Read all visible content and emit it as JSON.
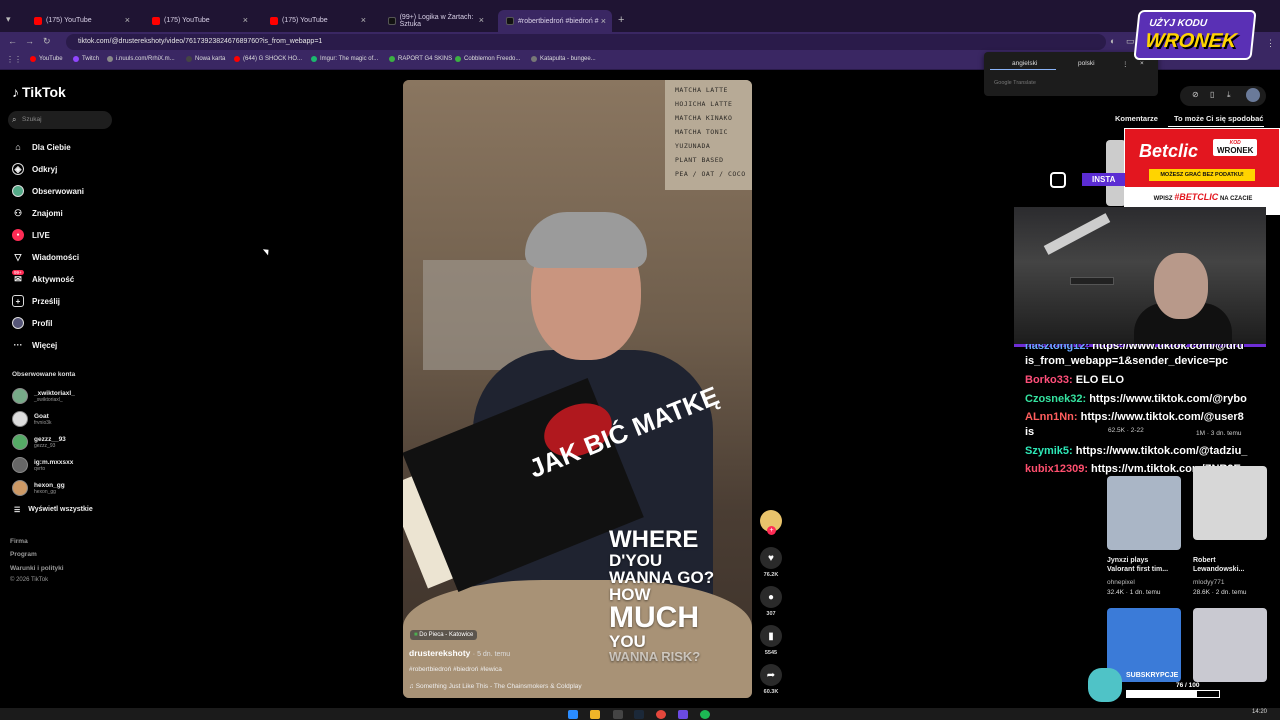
{
  "browser": {
    "tabs": [
      {
        "label": "(175) YouTube",
        "color": "#ff0000"
      },
      {
        "label": "(175) YouTube",
        "color": "#ff0000"
      },
      {
        "label": "(175) YouTube",
        "color": "#ff0000"
      },
      {
        "label": "(99+) Logika w Żartach: Sztuka",
        "color": "#111111"
      },
      {
        "label": "#robertbiedroń #biedroń #",
        "color": "#111111"
      }
    ],
    "url": "tiktok.com/@drusterekshoty/video/7617392382467689760?is_from_webapp=1",
    "bookmarks": [
      {
        "label": "YouTube",
        "color": "#ff0000"
      },
      {
        "label": "Twitch",
        "color": "#9146ff"
      },
      {
        "label": "i.nuuls.com/RrhiX.m...",
        "color": "#888888"
      },
      {
        "label": "Nowa karta",
        "color": "#444444"
      },
      {
        "label": "(644) G SHOCK HO...",
        "color": "#ff0000"
      },
      {
        "label": "Imgur: The magic of...",
        "color": "#1bb76e"
      },
      {
        "label": "RAPORT G4 SKINS",
        "color": "#3cb043"
      },
      {
        "label": "Cobblemon Freedo...",
        "color": "#3cb043"
      },
      {
        "label": "Katapulta - bungee...",
        "color": "#777777"
      }
    ]
  },
  "translate": {
    "lang_from": "angielski",
    "lang_to": "polski",
    "provider": "Google Translate"
  },
  "overlay": {
    "code_line1": "UŻYJ KODU",
    "code_line2": "WRONEK"
  },
  "tiktok": {
    "logo": "TikTok",
    "search_placeholder": "Szukaj",
    "nav": [
      {
        "label": "Dla Ciebie",
        "icon": "home-icon"
      },
      {
        "label": "Odkryj",
        "icon": "compass-icon"
      },
      {
        "label": "Obserwowani",
        "icon": "following-icon"
      },
      {
        "label": "Znajomi",
        "icon": "friends-icon"
      },
      {
        "label": "LIVE",
        "icon": "live-icon"
      },
      {
        "label": "Wiadomości",
        "icon": "messages-icon"
      },
      {
        "label": "Aktywność",
        "icon": "activity-icon"
      },
      {
        "label": "Prześlij",
        "icon": "upload-icon"
      },
      {
        "label": "Profil",
        "icon": "profile-icon"
      },
      {
        "label": "Więcej",
        "icon": "more-icon"
      }
    ],
    "activity_badge": "99+",
    "followed_title": "Obserwowane konta",
    "followed": [
      {
        "name": "_xwiktoriaxl_",
        "handle": "_xwiktoriaxl_"
      },
      {
        "name": "Goat",
        "handle": "frvnio3k"
      },
      {
        "name": "gezzz__93",
        "handle": "gezzz_93"
      },
      {
        "name": "ig:m.mxxsxx",
        "handle": "qvrto"
      },
      {
        "name": "hexon_gg",
        "handle": "hexon_gg"
      }
    ],
    "see_all": "Wyświetl wszystkie",
    "footer": [
      "Firma",
      "Program",
      "Warunki i polityki",
      "© 2026 TikTok"
    ]
  },
  "video": {
    "menu_lines": [
      "MATCHA LATTE",
      "HOJICHA LATTE",
      "MATCHA KINAKO",
      "MATCHA TONIC",
      "YUZUNADA",
      "PLANT BASED",
      "PEA / OAT / COCO"
    ],
    "book_title": "JAK BIĆ MATKĘ",
    "lyric_1": "WHERE",
    "lyric_2": "D'YOU",
    "lyric_3": "WANNA GO?",
    "lyric_4": "HOW",
    "lyric_5": "MUCH",
    "lyric_6": "YOU",
    "lyric_7": "WANNA RISK?",
    "location": "Do Pieca - Katowice",
    "author": "drusterekshoty",
    "time": "· 5 dn. temu",
    "tags": "#robertbiedroń #biedroń #lewica",
    "music": "Something Just Like This - The Chainsmokers & Coldplay",
    "likes": "76.2K",
    "comments": "307",
    "saves": "5545",
    "shares": "60.3K"
  },
  "right_panel": {
    "tab_comments": "Komentarze",
    "tab_maylike": "To może Ci się spodobać",
    "instagram_label": "INSTA",
    "betclic": {
      "logo": "Betclic",
      "code_small": "KOD",
      "code": "WRONEK",
      "tagline": "MOŻESZ GRAĆ BEZ PODATKU!",
      "footer_pre": "WPISZ",
      "footer_code": "#BETCLIC",
      "footer_post": "NA CZACIE"
    },
    "chat": [
      {
        "user": "nasztong12:",
        "msg": "https://www.tiktok.com/@dru",
        "color": "#6aa8ff"
      },
      {
        "user": "",
        "msg": "is_from_webapp=1&sender_device=pc",
        "color": "#ffffff"
      },
      {
        "user": "Borko33:",
        "msg": "ELO ELO",
        "color": "#ff4f7a"
      },
      {
        "user": "Czosnek32:",
        "msg": "https://www.tiktok.com/@rybo",
        "color": "#35e3a0"
      },
      {
        "user": "ALnn1Nn:",
        "msg": "https://www.tiktok.com/@user8",
        "color": "#ff5e5e"
      },
      {
        "user": "",
        "msg": "is",
        "color": "#ffffff"
      },
      {
        "user": "Szymik5:",
        "msg": "https://www.tiktok.com/@tadziu_",
        "color": "#2ee8b7"
      },
      {
        "user": "kubix12309:",
        "msg": "https://vm.tiktok.com/ZNR9E",
        "color": "#ff4f6e"
      }
    ],
    "mini_stats_left": "62.5K · 2-22",
    "mini_stats_right": "1M · 3 dn. temu",
    "cards": [
      {
        "title": "Jynxzi plays Valorant first tim...",
        "author": "ohnepixel",
        "stats": "32.4K · 1 dn. temu"
      },
      {
        "title": "Robert Lewandowski...",
        "author": "mlodyy771",
        "stats": "28.6K · 2 dn. temu"
      }
    ],
    "sub_label": "SUBSKRYPCJE",
    "sub_count": "76 / 100",
    "sub_fraction": 0.76
  },
  "taskbar": {
    "clock": "14:20"
  }
}
